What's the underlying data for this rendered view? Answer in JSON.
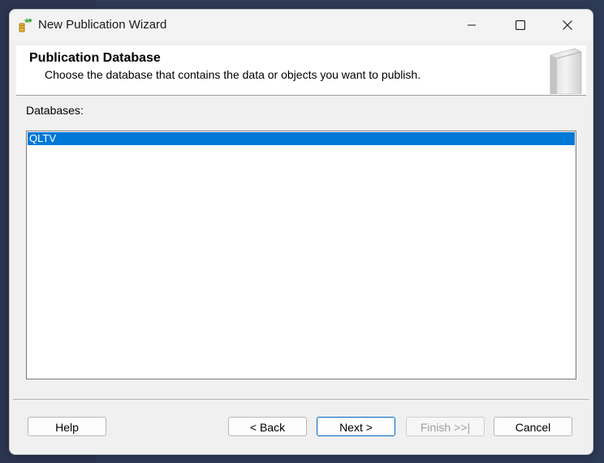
{
  "window": {
    "title": "New Publication Wizard"
  },
  "header": {
    "title": "Publication Database",
    "subtitle": "Choose the database that contains the data or objects you want to publish."
  },
  "databases": {
    "label": "Databases:",
    "items": [
      "QLTV"
    ],
    "selected": "QLTV"
  },
  "buttons": {
    "help": "Help",
    "back": "< Back",
    "next": "Next >",
    "finish": "Finish >>|",
    "cancel": "Cancel"
  },
  "colors": {
    "selection": "#0078d7",
    "primary_border": "#0067c0",
    "disabled_text": "#a0a0a0"
  },
  "icons": {
    "app": "publication-wizard-icon",
    "header": "book-icon",
    "minimize": "minimize-icon",
    "maximize": "maximize-icon",
    "close": "close-icon"
  }
}
